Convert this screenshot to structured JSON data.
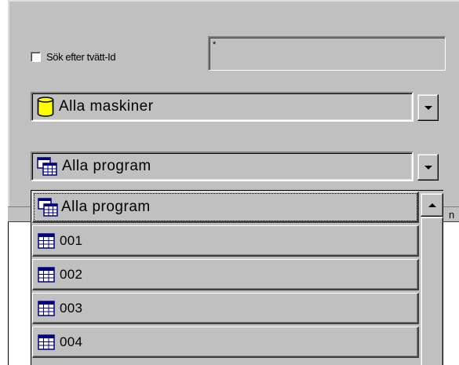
{
  "search": {
    "checkbox_label": "Sök efter tvätt-Id",
    "checked": false,
    "input_value": "*"
  },
  "machine_combo": {
    "selected": "Alla maskiner",
    "icon": "database-icon"
  },
  "program_combo": {
    "selected": "Alla program",
    "icon": "programs-icon",
    "options": [
      {
        "label": "Alla program",
        "icon": "programs-icon"
      },
      {
        "label": "001",
        "icon": "table-icon"
      },
      {
        "label": "002",
        "icon": "table-icon"
      },
      {
        "label": "003",
        "icon": "table-icon"
      },
      {
        "label": "004",
        "icon": "table-icon"
      }
    ]
  },
  "grid": {
    "header_fragment": "n"
  },
  "colors": {
    "face": "#c0c0c0",
    "highlight": "#ffffff",
    "shadow": "#808080",
    "dark_shadow": "#404040",
    "icon_yellow": "#ffff00",
    "icon_navy": "#000080"
  }
}
